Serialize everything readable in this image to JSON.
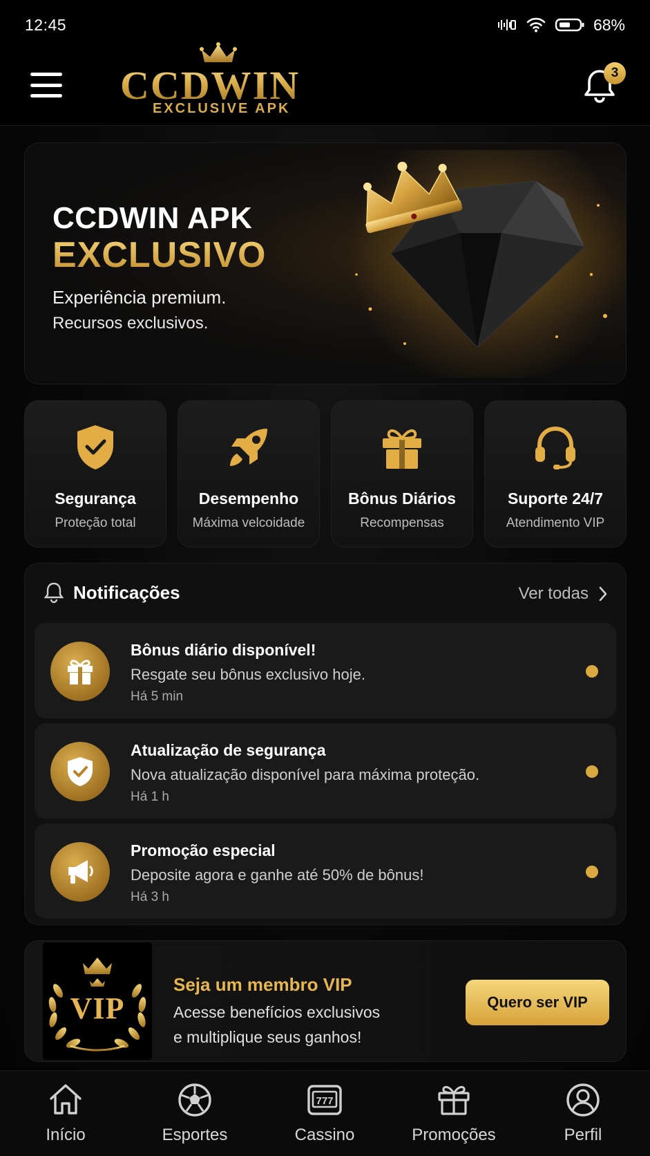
{
  "status_bar": {
    "time": "12:45",
    "battery": "68%"
  },
  "header": {
    "logo_text": "CCDWIN",
    "logo_tagline": "EXCLUSIVE APK",
    "notification_count": "3"
  },
  "hero": {
    "title_line1": "CCDWIN APK",
    "title_line2": "EXCLUSIVO",
    "subtitle_line1": "Experiência premium.",
    "subtitle_line2": "Recursos exclusivos."
  },
  "features": [
    {
      "icon": "shield-check-icon",
      "title": "Segurança",
      "subtitle": "Proteção total"
    },
    {
      "icon": "rocket-icon",
      "title": "Desempenho",
      "subtitle": "Máxima velcoidade"
    },
    {
      "icon": "gift-icon",
      "title": "Bônus Diários",
      "subtitle": "Recompensas"
    },
    {
      "icon": "headset-icon",
      "title": "Suporte 24/7",
      "subtitle": "Atendimento VIP"
    }
  ],
  "notifications": {
    "title": "Notificações",
    "see_all": "Ver todas",
    "items": [
      {
        "icon": "gift-icon",
        "title": "Bônus diário disponível!",
        "description": "Resgate seu bônus exclusivo hoje.",
        "time": "Há 5 min"
      },
      {
        "icon": "shield-check-icon",
        "title": "Atualização de segurança",
        "description": "Nova atualização disponível para máxima proteção.",
        "time": "Há 1 h"
      },
      {
        "icon": "megaphone-icon",
        "title": "Promoção especial",
        "description": "Deposite agora e ganhe até 50% de bônus!",
        "time": "Há 3 h"
      }
    ]
  },
  "vip": {
    "emblem_text": "VIP",
    "title": "Seja um membro VIP",
    "description_line1": "Acesse benefícios exclusivos",
    "description_line2": "e multiplique seus ganhos!",
    "button": "Quero ser VIP"
  },
  "bottom_nav": [
    {
      "icon": "home-icon",
      "label": "Início"
    },
    {
      "icon": "soccer-ball-icon",
      "label": "Esportes"
    },
    {
      "icon": "slot-machine-icon",
      "label": "Cassino"
    },
    {
      "icon": "gift-icon",
      "label": "Promoções"
    },
    {
      "icon": "user-icon",
      "label": "Perfil"
    }
  ],
  "colors": {
    "gold": "#d9a93f",
    "gold_light": "#f6d77b",
    "background": "#070707",
    "card": "#1a1a1a"
  }
}
